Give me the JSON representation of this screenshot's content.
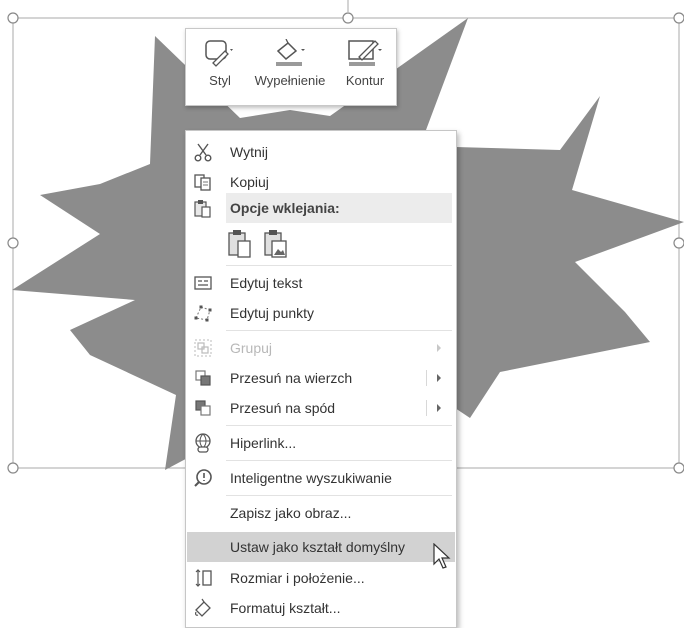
{
  "mini_toolbar": {
    "style_label": "Styl",
    "fill_label": "Wypełnienie",
    "outline_label": "Kontur"
  },
  "context_menu": {
    "cut": "Wytnij",
    "copy": "Kopiuj",
    "paste_options": "Opcje wklejania:",
    "edit_text": "Edytuj tekst",
    "edit_points": "Edytuj punkty",
    "group": "Grupuj",
    "bring_forward": "Przesuń na wierzch",
    "send_backward": "Przesuń na spód",
    "hyperlink": "Hiperlink...",
    "smart_lookup": "Inteligentne wyszukiwanie",
    "save_as_picture": "Zapisz jako obraz...",
    "set_default_shape": "Ustaw jako kształt domyślny",
    "size_position": "Rozmiar i położenie...",
    "format_shape": "Formatuj kształt..."
  },
  "colors": {
    "shape_fill": "#8c8c8c",
    "menu_highlight": "#d2d2d2",
    "disabled_text": "#b8b8b8"
  }
}
